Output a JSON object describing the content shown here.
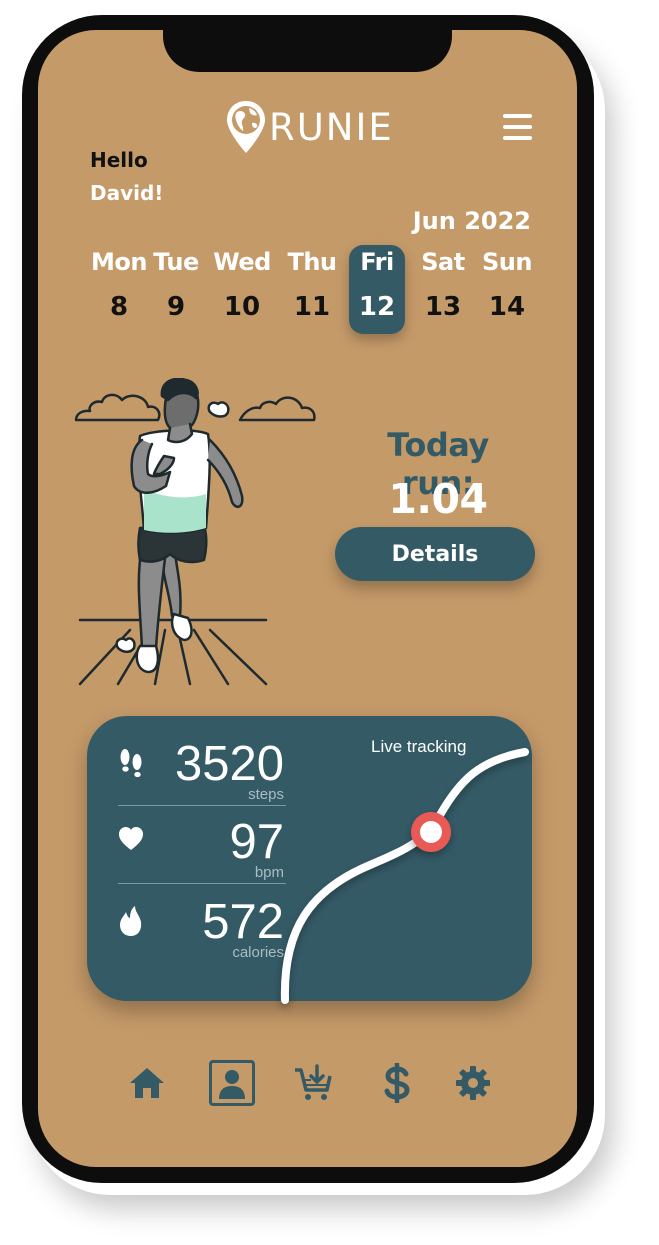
{
  "app": {
    "logo_text": "RUNIE"
  },
  "greeting": {
    "hello": "Hello",
    "name": "David!"
  },
  "calendar": {
    "month": "Jun 2022",
    "days": [
      {
        "name": "Mon",
        "date": "8"
      },
      {
        "name": "Tue",
        "date": "9"
      },
      {
        "name": "Wed",
        "date": "10"
      },
      {
        "name": "Thu",
        "date": "11"
      },
      {
        "name": "Fri",
        "date": "12",
        "selected": true
      },
      {
        "name": "Sat",
        "date": "13"
      },
      {
        "name": "Sun",
        "date": "14"
      }
    ]
  },
  "today_run": {
    "label": "Today run:",
    "value": "1.04 km",
    "details_label": "Details"
  },
  "stats": {
    "steps": {
      "value": "3520",
      "unit": "steps",
      "icon": "footsteps-icon"
    },
    "bpm": {
      "value": "97",
      "unit": "bpm",
      "icon": "heart-icon"
    },
    "calories": {
      "value": "572",
      "unit": "calories",
      "icon": "flame-icon"
    },
    "live_tracking_label": "Live tracking"
  },
  "bottom_nav": [
    {
      "icon": "home-icon"
    },
    {
      "icon": "profile-icon",
      "active": true
    },
    {
      "icon": "cart-download-icon"
    },
    {
      "icon": "dollar-icon"
    },
    {
      "icon": "gear-icon"
    }
  ],
  "colors": {
    "background": "#c59a69",
    "accent": "#345a66",
    "text_light": "#ffffff",
    "marker": "#e85a55"
  }
}
